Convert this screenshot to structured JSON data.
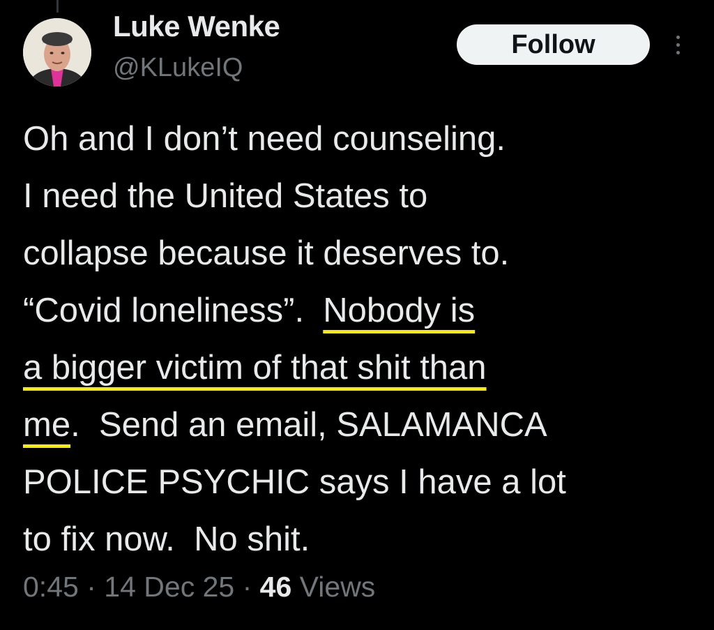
{
  "tweet": {
    "author": {
      "display_name": "Luke Wenke",
      "handle": "@KLukeIQ"
    },
    "follow_label": "Follow",
    "more_icon": "more-vertical-icon",
    "body": {
      "line1": "Oh and I don’t need counseling.",
      "line2": "I need the United States to",
      "line3": "collapse because it deserves to.",
      "line4_plain": "“Covid loneliness”.  ",
      "line4_highlight": "Nobody is",
      "line5_highlight": "a bigger victim of that shit than",
      "line6_highlight": "me",
      "line6_plain": ".  Send an email, SALAMANCA",
      "line7": "POLICE PSYCHIC says I have a lot",
      "line8": "to fix now.  No shit."
    },
    "meta": {
      "time": "0:45",
      "separator": "·",
      "date": "14 Dec 25",
      "views_count": "46",
      "views_label": "Views"
    }
  },
  "colors": {
    "background": "#000000",
    "text_primary": "#e7e9ea",
    "text_secondary": "#71767b",
    "follow_bg": "#eff3f4",
    "highlight_underline": "#f5ea14"
  }
}
